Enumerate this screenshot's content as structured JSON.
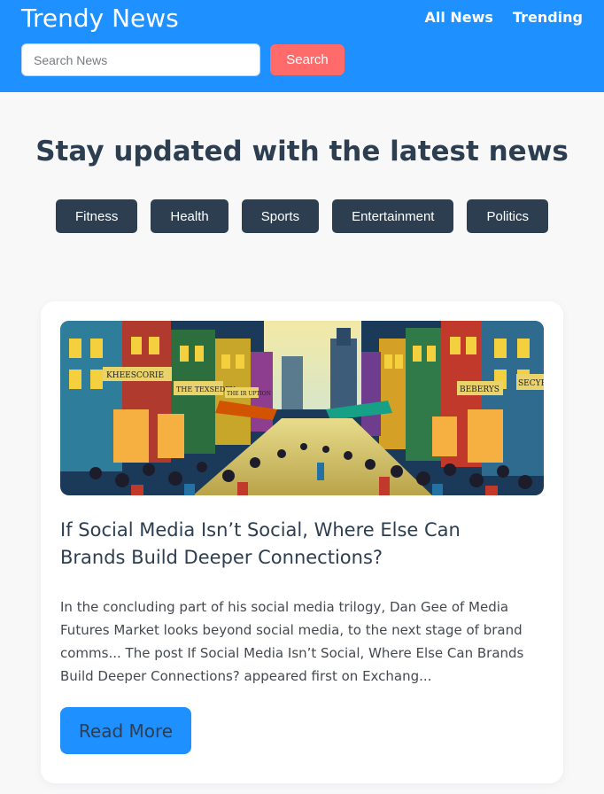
{
  "header": {
    "brand": "Trendy News",
    "nav": [
      "All News",
      "Trending"
    ],
    "search": {
      "placeholder": "Search News",
      "button_label": "Search"
    }
  },
  "hero": {
    "headline": "Stay updated with the latest news",
    "categories": [
      "Fitness",
      "Health",
      "Sports",
      "Entertainment",
      "Politics"
    ]
  },
  "article": {
    "image_icon": "illustration-busy-colorful-city-street",
    "image_signs": [
      "KHEESCORIE",
      "THE TEXSEDEY",
      "THE IR UPTION",
      "BEBERYS",
      "SECYP"
    ],
    "title": "If Social Media Isn’t Social, Where Else Can Brands Build Deeper Connections?",
    "description": "In the concluding part of his social media trilogy, Dan Gee of Media Futures Market looks beyond social media, to the next stage of brand comms... The post If Social Media Isn’t Social, Where Else Can Brands Build Deeper Connections? appeared first on Exchang...",
    "button_label": "Read More"
  },
  "colors": {
    "header_bg": "#1e90ff",
    "search_button": "#ff6b6b",
    "category_bg": "#2c3e50",
    "read_more_bg": "#1e90ff",
    "page_bg": "#f8f8f9"
  }
}
